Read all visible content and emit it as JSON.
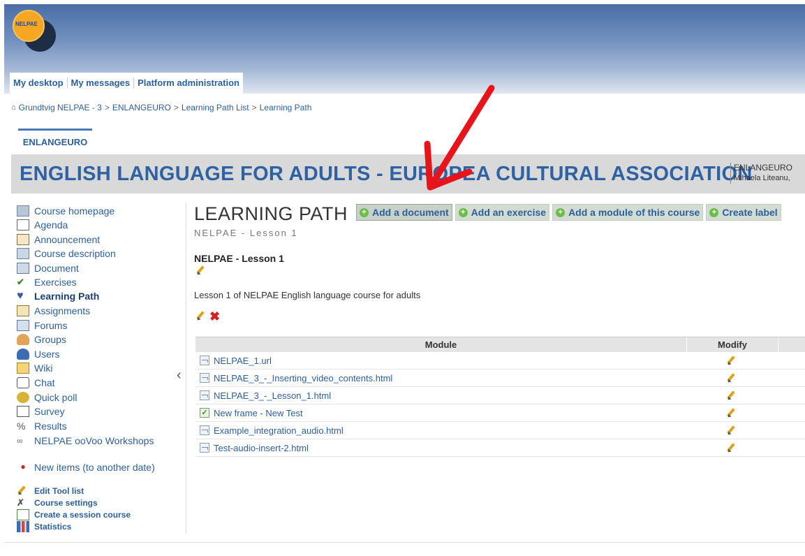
{
  "header": {
    "logo_text": "NELPAE"
  },
  "nav": {
    "tabs": [
      "My desktop",
      "My messages",
      "Platform administration"
    ]
  },
  "breadcrumb": [
    "Grundtvig NELPAE - 3",
    "ENLANGEURO",
    "Learning Path List",
    "Learning Path"
  ],
  "course_tab": "ENLANGEURO",
  "banner": {
    "title": "ENGLISH LANGUAGE FOR ADULTS - EUROPEA CULTURAL ASSOCIATION",
    "code": "ENLANGEURO",
    "teacher": "Mihaela Liteanu,"
  },
  "sidebar": {
    "items": [
      {
        "label": "Course homepage",
        "icon": "home-icon"
      },
      {
        "label": "Agenda",
        "icon": "calendar-icon"
      },
      {
        "label": "Announcement",
        "icon": "announcement-icon"
      },
      {
        "label": "Course description",
        "icon": "description-icon"
      },
      {
        "label": "Document",
        "icon": "folder-icon"
      },
      {
        "label": "Exercises",
        "icon": "checkbox-icon"
      },
      {
        "label": "Learning Path",
        "icon": "learning-path-icon"
      },
      {
        "label": "Assignments",
        "icon": "assignment-icon"
      },
      {
        "label": "Forums",
        "icon": "forum-icon"
      },
      {
        "label": "Groups",
        "icon": "groups-icon"
      },
      {
        "label": "Users",
        "icon": "user-icon"
      },
      {
        "label": "Wiki",
        "icon": "wiki-icon"
      },
      {
        "label": "Chat",
        "icon": "chat-icon"
      },
      {
        "label": "Quick poll",
        "icon": "poll-icon"
      },
      {
        "label": "Survey",
        "icon": "survey-icon"
      },
      {
        "label": "Results",
        "icon": "results-icon"
      },
      {
        "label": "NELPAE ooVoo Workshops",
        "icon": "link-icon"
      }
    ],
    "new_items": "New items (to another date)",
    "admin": [
      "Edit Tool list",
      "Course settings",
      "Create a session course",
      "Statistics"
    ]
  },
  "main": {
    "title": "LEARNING PATH",
    "subtitle": "NELPAE - Lesson 1",
    "actions": [
      "Add a document",
      "Add an exercise",
      "Add a module of this course",
      "Create label"
    ],
    "lesson_name": "NELPAE - Lesson 1",
    "description": "Lesson 1 of NELPAE English language course for adults"
  },
  "table": {
    "headers": [
      "Module",
      "Modify"
    ],
    "rows": [
      {
        "name": "NELPAE_1.url",
        "type": "document"
      },
      {
        "name": "NELPAE_3_-_Inserting_video_contents.html",
        "type": "document"
      },
      {
        "name": "NELPAE_3_-_Lesson_1.html",
        "type": "document"
      },
      {
        "name": "New frame - New Test",
        "type": "quiz"
      },
      {
        "name": "Example_integration_audio.html",
        "type": "document"
      },
      {
        "name": "Test-audio-insert-2.html",
        "type": "document"
      }
    ]
  },
  "colors": {
    "accent": "#2f62a3",
    "arrow": "#e8141c",
    "banner_bg": "#d9d9d9"
  }
}
